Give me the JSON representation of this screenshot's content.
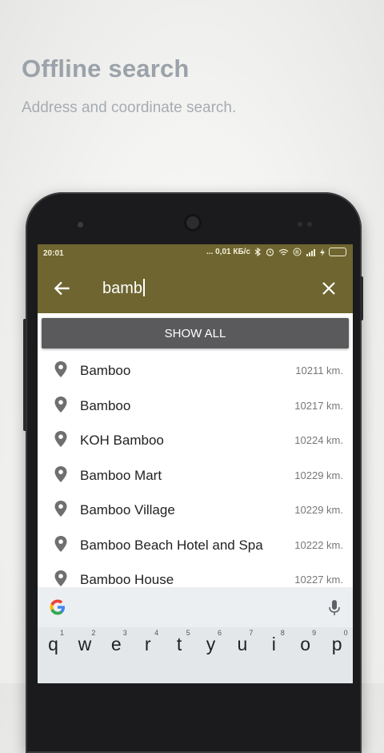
{
  "promo": {
    "title": "Offline search",
    "subtitle": "Address and coordinate search."
  },
  "status_bar": {
    "time": "20:01",
    "network_speed": "... 0,01 КБ/с"
  },
  "search": {
    "query": "bamb"
  },
  "show_all_label": "SHOW ALL",
  "results": [
    {
      "name": "Bamboo",
      "distance": "10211 km."
    },
    {
      "name": "Bamboo",
      "distance": "10217 km."
    },
    {
      "name": "KOH Bamboo",
      "distance": "10224 km."
    },
    {
      "name": "Bamboo Mart",
      "distance": "10229 km."
    },
    {
      "name": "Bamboo Village",
      "distance": "10229 km."
    },
    {
      "name": "Bamboo Beach Hotel and Spa",
      "distance": "10222 km."
    },
    {
      "name": "Bamboo House",
      "distance": "10227 km."
    }
  ],
  "keyboard": {
    "keys": [
      {
        "letter": "q",
        "hint": "1"
      },
      {
        "letter": "w",
        "hint": "2"
      },
      {
        "letter": "e",
        "hint": "3"
      },
      {
        "letter": "r",
        "hint": "4"
      },
      {
        "letter": "t",
        "hint": "5"
      },
      {
        "letter": "y",
        "hint": "6"
      },
      {
        "letter": "u",
        "hint": "7"
      },
      {
        "letter": "i",
        "hint": "8"
      },
      {
        "letter": "o",
        "hint": "9"
      },
      {
        "letter": "p",
        "hint": "0"
      }
    ]
  },
  "colors": {
    "appbar": "#6e6530",
    "show_all_bg": "#5a5a5c",
    "pin": "#6f6f6f"
  },
  "icons": {
    "back": "arrow-left-icon",
    "clear": "close-icon",
    "result": "map-pin-icon",
    "assistant": "google-g-icon",
    "voice": "microphone-icon"
  }
}
